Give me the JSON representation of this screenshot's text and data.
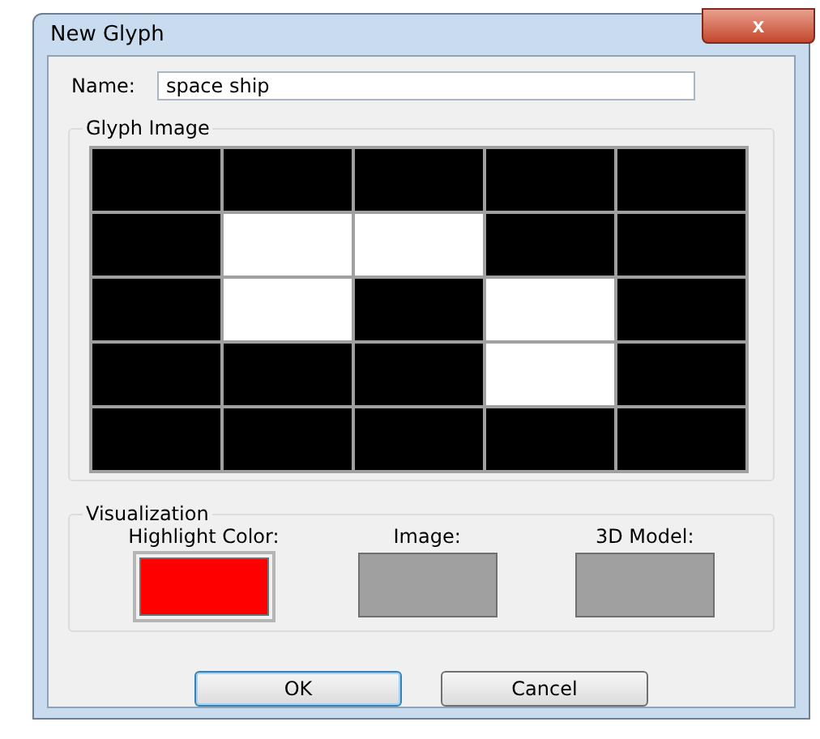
{
  "window": {
    "title": "New Glyph",
    "close_label": "x"
  },
  "name_field": {
    "label": "Name:",
    "value": "space ship"
  },
  "glyph_image": {
    "title": "Glyph Image",
    "rows": [
      {
        "cells": [
          {
            "filled": true
          },
          {
            "filled": true
          },
          {
            "filled": true
          },
          {
            "filled": true
          },
          {
            "filled": true
          }
        ]
      },
      {
        "cells": [
          {
            "filled": true
          },
          {
            "filled": false
          },
          {
            "filled": false
          },
          {
            "filled": true
          },
          {
            "filled": true
          }
        ]
      },
      {
        "cells": [
          {
            "filled": true
          },
          {
            "filled": false
          },
          {
            "filled": true
          },
          {
            "filled": false
          },
          {
            "filled": true
          }
        ]
      },
      {
        "cells": [
          {
            "filled": true
          },
          {
            "filled": true
          },
          {
            "filled": true
          },
          {
            "filled": false
          },
          {
            "filled": true
          }
        ]
      },
      {
        "cells": [
          {
            "filled": true
          },
          {
            "filled": true
          },
          {
            "filled": true
          },
          {
            "filled": true
          },
          {
            "filled": true
          }
        ]
      }
    ]
  },
  "visualization": {
    "title": "Visualization",
    "items": [
      {
        "label": "Highlight Color:",
        "color": "#ff0000",
        "selected": true
      },
      {
        "label": "Image:",
        "color": "#a0a0a0",
        "selected": false
      },
      {
        "label": "3D Model:",
        "color": "#a0a0a0",
        "selected": false
      }
    ]
  },
  "buttons": [
    {
      "label": "OK",
      "default": true
    },
    {
      "label": "Cancel",
      "default": false
    }
  ]
}
